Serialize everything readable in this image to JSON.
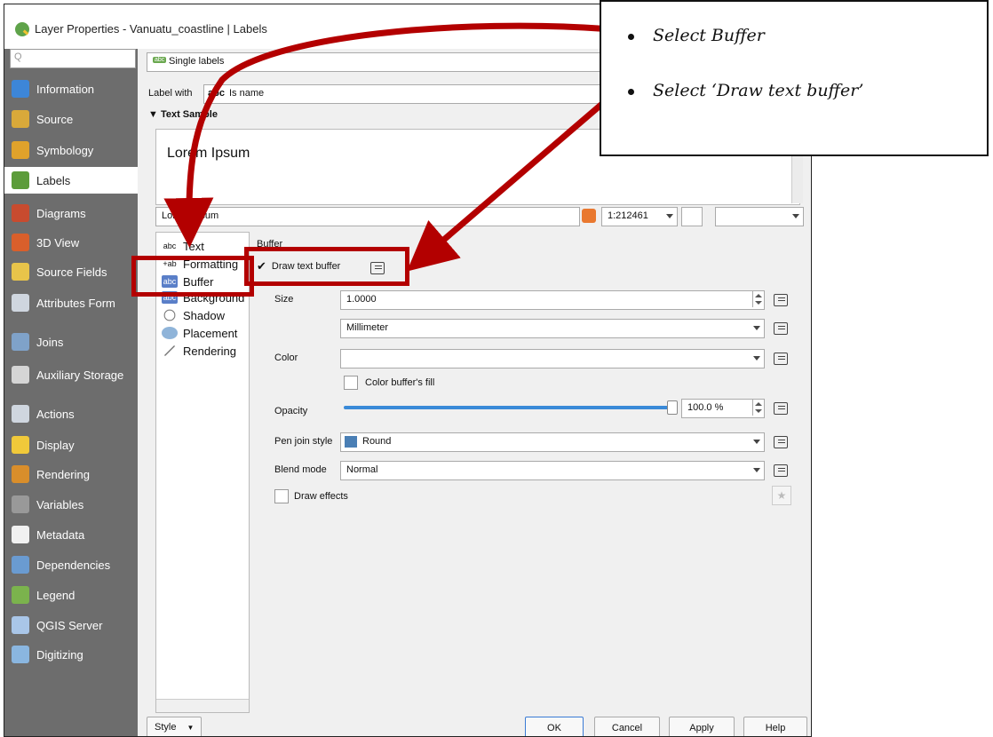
{
  "window": {
    "title": "Layer Properties - Vanuatu_coastline | Labels"
  },
  "sidebar": {
    "search_placeholder": "Q",
    "items": [
      {
        "label": "Information",
        "icon": "info-icon",
        "color": "#3d86d8"
      },
      {
        "label": "Source",
        "icon": "source-icon",
        "color": "#d9a93a"
      },
      {
        "label": "Symbology",
        "icon": "symbology-icon",
        "color": "#e0a22b"
      },
      {
        "label": "Labels",
        "icon": "labels-icon",
        "color": "#5c9c3a",
        "selected": true
      },
      {
        "label": "Diagrams",
        "icon": "diagrams-icon",
        "color": "#c84b2f"
      },
      {
        "label": "3D View",
        "icon": "3d-view-icon",
        "color": "#d95f2b"
      },
      {
        "label": "Source Fields",
        "icon": "source-fields-icon",
        "color": "#e8c44a"
      },
      {
        "label": "Attributes Form",
        "icon": "attributes-form-icon",
        "color": "#cfd6df"
      },
      {
        "label": "Joins",
        "icon": "joins-icon",
        "color": "#7fa2c9"
      },
      {
        "label": "Auxiliary Storage",
        "icon": "auxiliary-storage-icon",
        "color": "#d5d5d5"
      },
      {
        "label": "Actions",
        "icon": "actions-icon",
        "color": "#cfd6df"
      },
      {
        "label": "Display",
        "icon": "display-icon",
        "color": "#f0c93a"
      },
      {
        "label": "Rendering",
        "icon": "rendering-icon",
        "color": "#d98e2b"
      },
      {
        "label": "Variables",
        "icon": "variables-icon",
        "color": "#999999"
      },
      {
        "label": "Metadata",
        "icon": "metadata-icon",
        "color": "#f1f1f1"
      },
      {
        "label": "Dependencies",
        "icon": "dependencies-icon",
        "color": "#6a9bd1"
      },
      {
        "label": "Legend",
        "icon": "legend-icon",
        "color": "#7bb34d"
      },
      {
        "label": "QGIS Server",
        "icon": "qgis-server-icon",
        "color": "#a9c6e8"
      },
      {
        "label": "Digitizing",
        "icon": "digitizing-icon",
        "color": "#8ab6e0"
      }
    ]
  },
  "labels_mode": {
    "value": "Single labels",
    "badge": "abc"
  },
  "label_with": {
    "label": "Label with",
    "prefix": "abc",
    "value": "Is name"
  },
  "text_sample": {
    "heading": "Text Sample",
    "preview": "Lorem Ipsum",
    "input_value": "Lorem Ipsum",
    "scale": "1:212461"
  },
  "tabs": [
    {
      "label": "Text",
      "icon": "abc"
    },
    {
      "label": "Formatting",
      "icon": "+ab"
    },
    {
      "label": "Buffer",
      "icon": "abc"
    },
    {
      "label": "Background",
      "icon": "abc"
    },
    {
      "label": "Shadow",
      "icon": "shadow-icon"
    },
    {
      "label": "Placement",
      "icon": "placement-icon"
    },
    {
      "label": "Rendering",
      "icon": "rendering-brush-icon"
    }
  ],
  "buffer": {
    "section_title": "Buffer",
    "draw_text_buffer": {
      "label": "Draw text buffer",
      "checked": true
    },
    "size": {
      "label": "Size",
      "value": "1.0000",
      "unit": "Millimeter"
    },
    "color": {
      "label": "Color",
      "fill_label": "Color buffer's fill"
    },
    "opacity": {
      "label": "Opacity",
      "value": "100.0 %",
      "fraction": 1.0
    },
    "pen_join_style": {
      "label": "Pen join style",
      "value": "Round"
    },
    "blend_mode": {
      "label": "Blend mode",
      "value": "Normal"
    },
    "draw_effects": {
      "label": "Draw effects"
    }
  },
  "footer": {
    "style": "Style",
    "ok": "OK",
    "cancel": "Cancel",
    "apply": "Apply",
    "help": "Help"
  },
  "callout": {
    "items": [
      "Select Buffer",
      "Select ‘Draw text buffer’"
    ]
  },
  "colors": {
    "annotation_red": "#b30000",
    "sidebar_bg": "#6d6d6d",
    "opacity_slider": "#3a8ad8"
  }
}
